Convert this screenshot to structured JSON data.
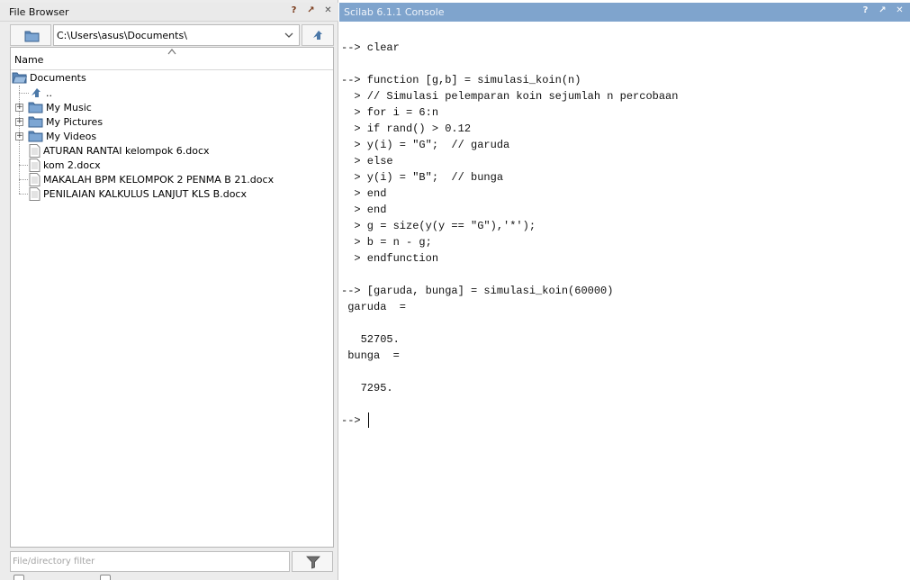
{
  "file_browser": {
    "title": "File Browser",
    "title_buttons": [
      "?",
      "↗",
      "✕"
    ],
    "path": "C:\\Users\\asus\\Documents\\",
    "column_header": "Name",
    "root": {
      "label": "Documents",
      "icon": "folder-open-icon"
    },
    "parent_entry": {
      "label": "..",
      "icon": "up-arrow-icon"
    },
    "items": [
      {
        "label": "My Music",
        "type": "folder",
        "expandable": true
      },
      {
        "label": "My Pictures",
        "type": "folder",
        "expandable": true
      },
      {
        "label": "My Videos",
        "type": "folder",
        "expandable": true
      },
      {
        "label": "ATURAN RANTAI kelompok 6.docx",
        "type": "file",
        "expandable": false
      },
      {
        "label": "kom 2.docx",
        "type": "file",
        "expandable": false
      },
      {
        "label": "MAKALAH BPM KELOMPOK 2 PENMA B 21.docx",
        "type": "file",
        "expandable": false
      },
      {
        "label": "PENILAIAN KALKULUS LANJUT KLS B.docx",
        "type": "file",
        "expandable": false
      }
    ],
    "filter_placeholder": "File/directory filter"
  },
  "console": {
    "title": "Scilab 6.1.1 Console",
    "title_buttons": [
      "?",
      "↗",
      "✕"
    ],
    "lines": [
      "--> clear",
      "",
      "--> function [g,b] = simulasi_koin(n)",
      "  > // Simulasi pelemparan koin sejumlah n percobaan",
      "  > for i = 6:n",
      "  > if rand() > 0.12",
      "  > y(i) = \"G\";  // garuda",
      "  > else",
      "  > y(i) = \"B\";  // bunga",
      "  > end",
      "  > end",
      "  > g = size(y(y == \"G\"),'*');",
      "  > b = n - g;",
      "  > endfunction",
      "",
      "--> [garuda, bunga] = simulasi_koin(60000)",
      " garuda  =",
      "",
      "   52705.",
      " bunga  =",
      "",
      "   7295.",
      "",
      "--> "
    ]
  }
}
